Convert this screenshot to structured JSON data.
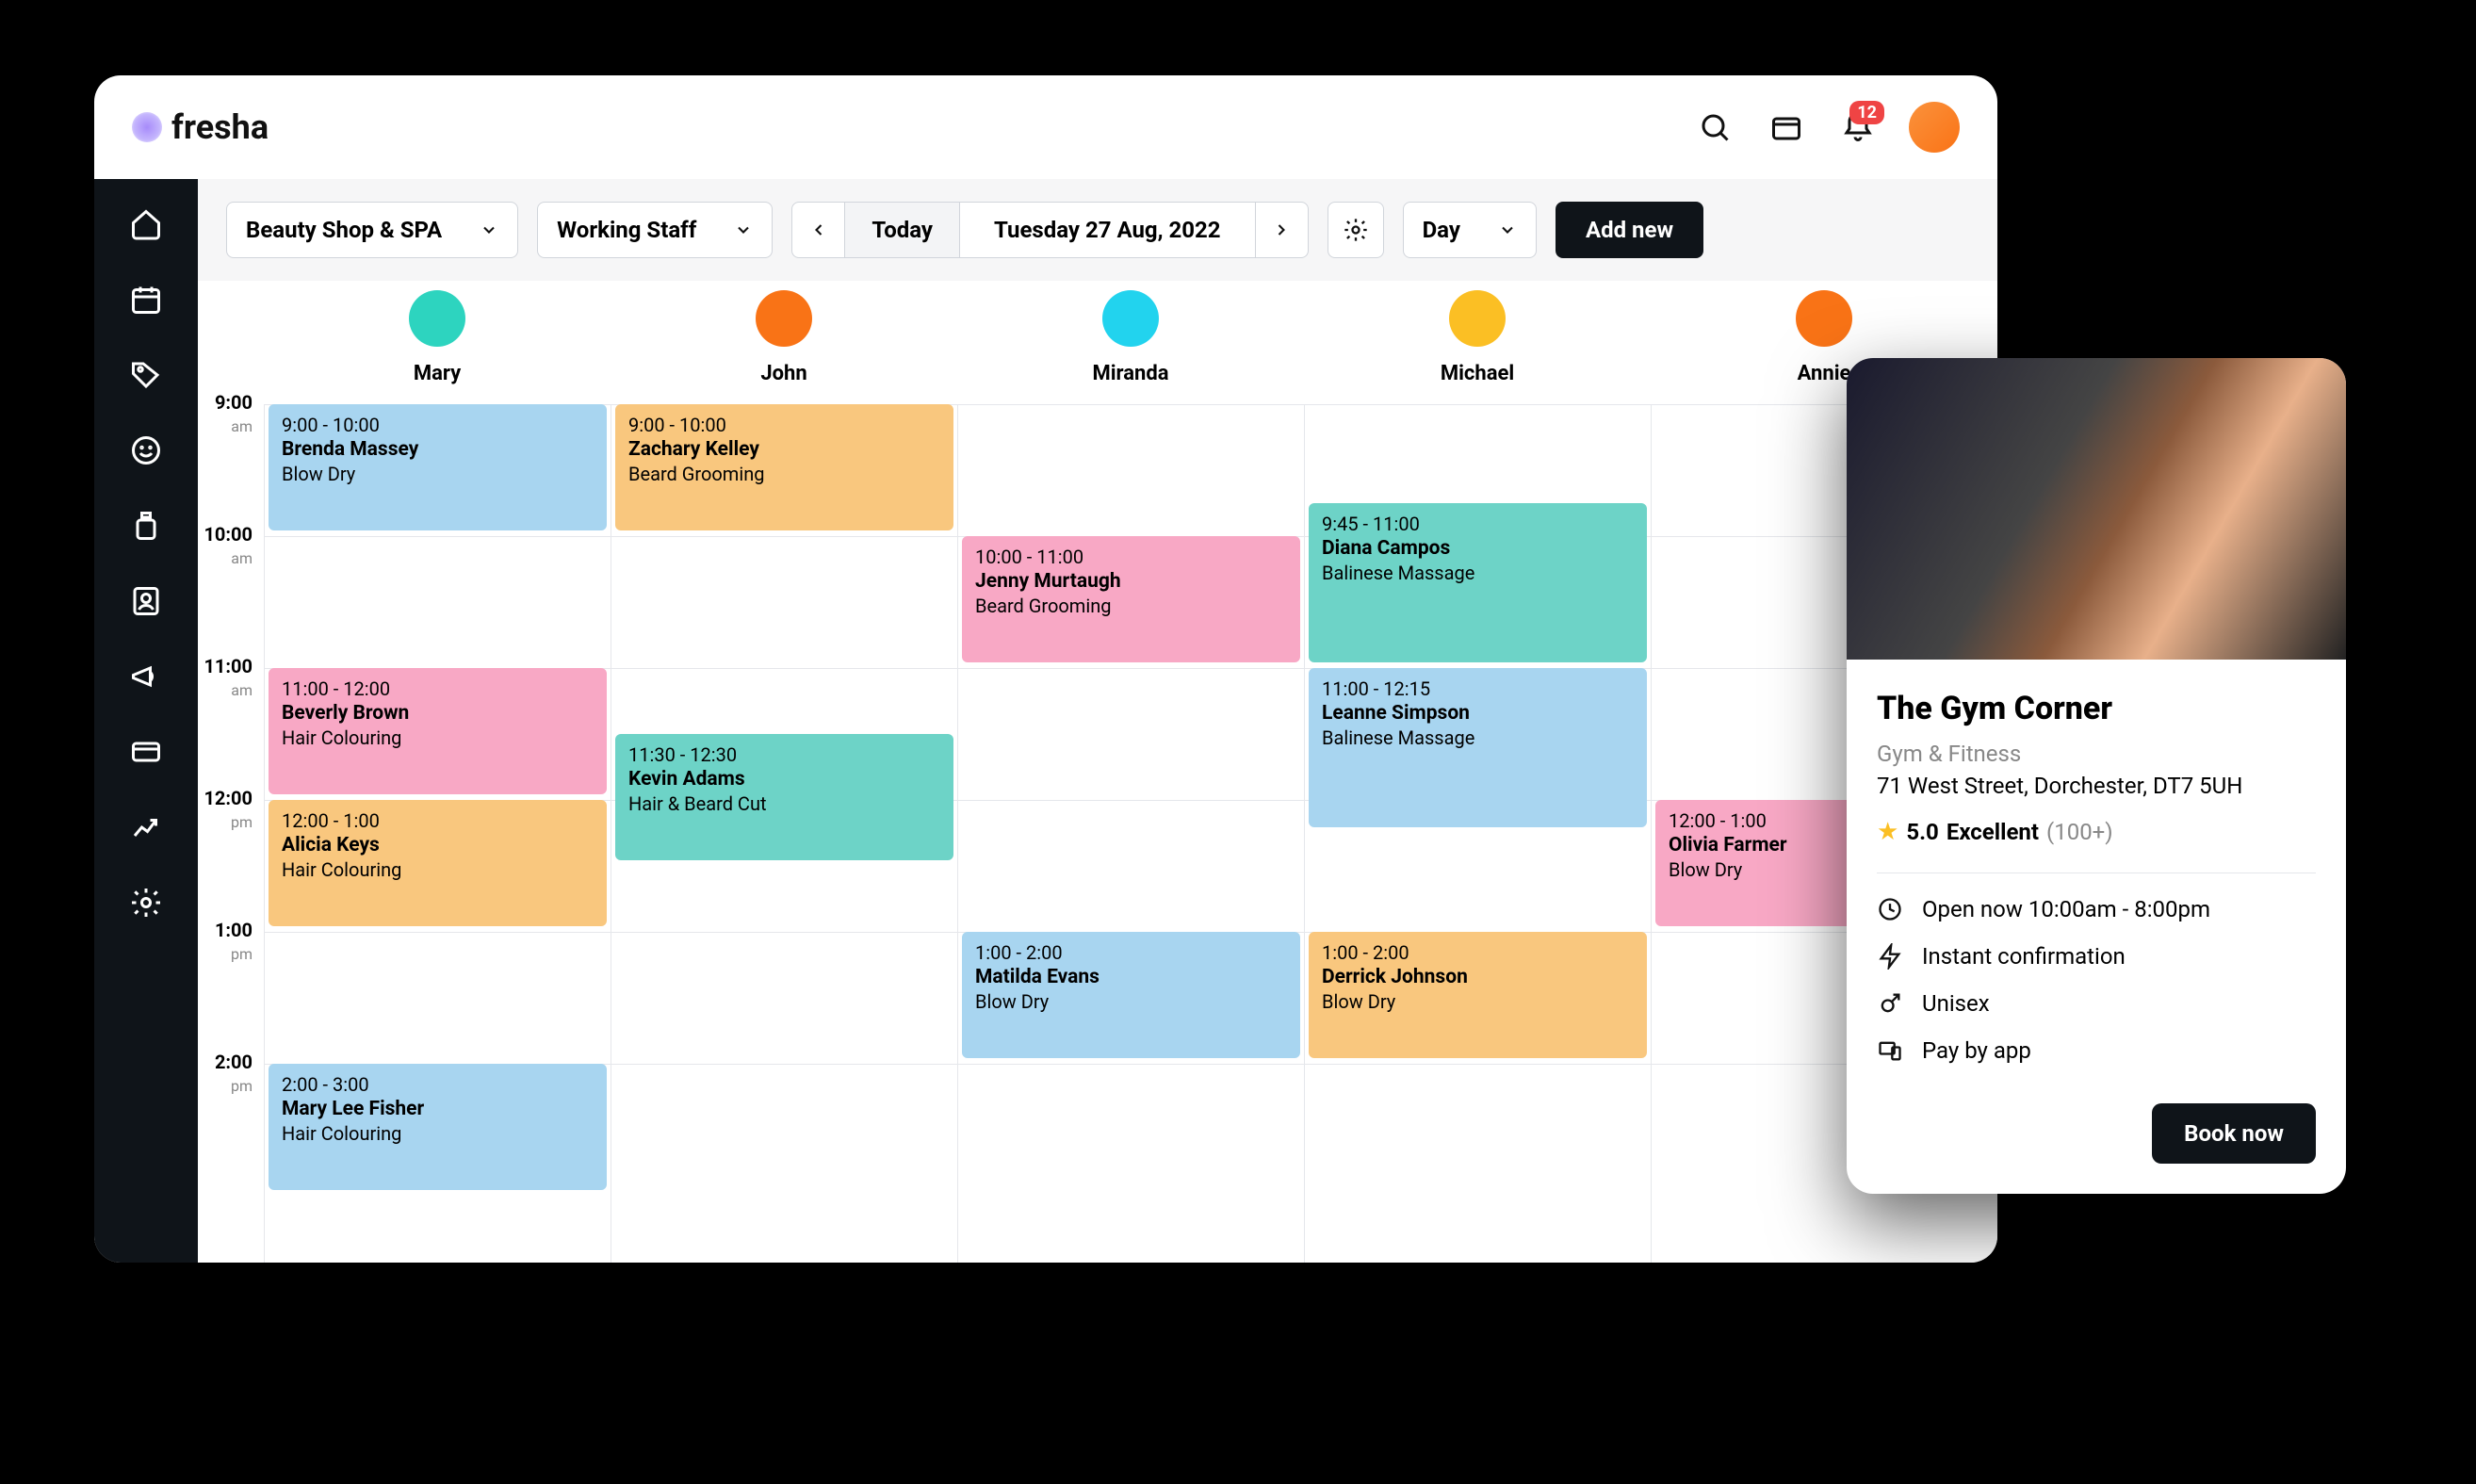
{
  "brand": "fresha",
  "notification_count": "12",
  "toolbar": {
    "location": "Beauty Shop & SPA",
    "filter": "Working Staff",
    "today": "Today",
    "date": "Tuesday 27 Aug, 2022",
    "view": "Day",
    "add": "Add new"
  },
  "staff": [
    "Mary",
    "John",
    "Miranda",
    "Michael",
    "Annie"
  ],
  "staff_colors": [
    "#2dd4bf",
    "#f97316",
    "#22d3ee",
    "#fbbf24",
    "#f97316"
  ],
  "hours": [
    {
      "t": "9:00",
      "ap": "am"
    },
    {
      "t": "10:00",
      "ap": "am"
    },
    {
      "t": "11:00",
      "ap": "am"
    },
    {
      "t": "12:00",
      "ap": "pm"
    },
    {
      "t": "1:00",
      "ap": "pm"
    },
    {
      "t": "2:00",
      "ap": "pm"
    }
  ],
  "events": [
    {
      "col": 0,
      "start": 0,
      "dur": 1,
      "time": "9:00 - 10:00",
      "name": "Brenda Massey",
      "service": "Blow Dry",
      "color": "c-blue"
    },
    {
      "col": 0,
      "start": 2,
      "dur": 1,
      "time": "11:00 - 12:00",
      "name": "Beverly Brown",
      "service": "Hair Colouring",
      "color": "c-pink"
    },
    {
      "col": 0,
      "start": 3,
      "dur": 1,
      "time": "12:00 - 1:00",
      "name": "Alicia Keys",
      "service": "Hair Colouring",
      "color": "c-orange"
    },
    {
      "col": 0,
      "start": 5,
      "dur": 1,
      "time": "2:00 - 3:00",
      "name": "Mary Lee Fisher",
      "service": "Hair Colouring",
      "color": "c-blue"
    },
    {
      "col": 1,
      "start": 0,
      "dur": 1,
      "time": "9:00 - 10:00",
      "name": "Zachary Kelley",
      "service": "Beard Grooming",
      "color": "c-orange"
    },
    {
      "col": 1,
      "start": 2.5,
      "dur": 1,
      "time": "11:30 - 12:30",
      "name": "Kevin Adams",
      "service": "Hair & Beard Cut",
      "color": "c-teal"
    },
    {
      "col": 2,
      "start": 1,
      "dur": 1,
      "time": "10:00 - 11:00",
      "name": "Jenny Murtaugh",
      "service": "Beard Grooming",
      "color": "c-pink"
    },
    {
      "col": 2,
      "start": 4,
      "dur": 1,
      "time": "1:00 - 2:00",
      "name": "Matilda Evans",
      "service": "Blow Dry",
      "color": "c-blue"
    },
    {
      "col": 3,
      "start": 0.75,
      "dur": 1.25,
      "time": "9:45 - 11:00",
      "name": "Diana Campos",
      "service": "Balinese Massage",
      "color": "c-teal"
    },
    {
      "col": 3,
      "start": 2,
      "dur": 1.25,
      "time": "11:00 - 12:15",
      "name": "Leanne Simpson",
      "service": "Balinese Massage",
      "color": "c-blue"
    },
    {
      "col": 3,
      "start": 4,
      "dur": 1,
      "time": "1:00 - 2:00",
      "name": "Derrick Johnson",
      "service": "Blow Dry",
      "color": "c-orange"
    },
    {
      "col": 4,
      "start": 3,
      "dur": 1,
      "time": "12:00 - 1:00",
      "name": "Olivia Farmer",
      "service": "Blow Dry",
      "color": "c-pink"
    }
  ],
  "mobile": {
    "name": "The Gym Corner",
    "category": "Gym & Fitness",
    "address": "71 West Street, Dorchester, DT7 5UH",
    "rating_score": "5.0",
    "rating_label": "Excellent",
    "rating_count": "(100+)",
    "hours": "Open now 10:00am - 8:00pm",
    "confirm": "Instant confirmation",
    "gender": "Unisex",
    "pay": "Pay by app",
    "cta": "Book now"
  }
}
